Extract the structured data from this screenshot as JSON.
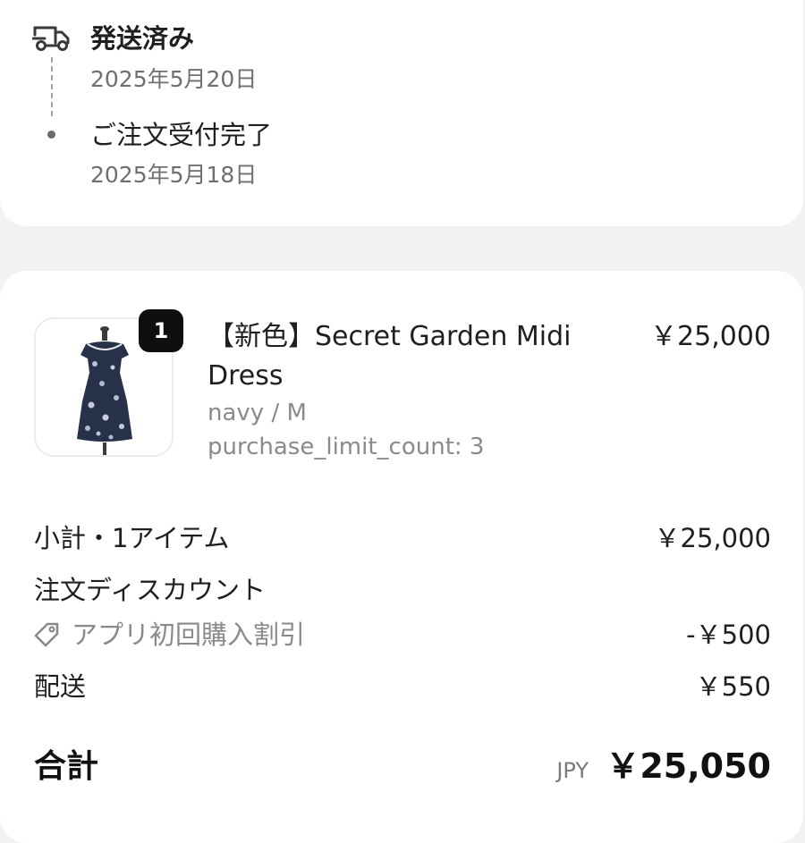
{
  "timeline": {
    "events": [
      {
        "title": "発送済み",
        "date": "2025年5月20日",
        "icon": "truck-icon"
      },
      {
        "title": "ご注文受付完了",
        "date": "2025年5月18日",
        "icon": "dot"
      }
    ]
  },
  "product": {
    "quantity": "1",
    "name": "【新色】Secret Garden Midi Dress",
    "price": "￥25,000",
    "variant": "navy / M",
    "limit": "purchase_limit_count: 3",
    "thumbnail": "dress-on-mannequin"
  },
  "summary": {
    "subtotal_label": "小計・1アイテム",
    "subtotal_value": "￥25,000",
    "discount_heading": "注文ディスカウント",
    "discount_name": "アプリ初回購入割引",
    "discount_value": "-￥500",
    "shipping_label": "配送",
    "shipping_value": "￥550",
    "total_label": "合計",
    "total_currency": "JPY",
    "total_value": "￥25,050"
  },
  "colors": {
    "page_background": "#f2f2f2",
    "card_background": "#ffffff",
    "primary_text": "#1f1f1f",
    "secondary_text": "#8a8a8a",
    "badge_background": "#0f0f0f",
    "dress_navy": "#27314a"
  }
}
